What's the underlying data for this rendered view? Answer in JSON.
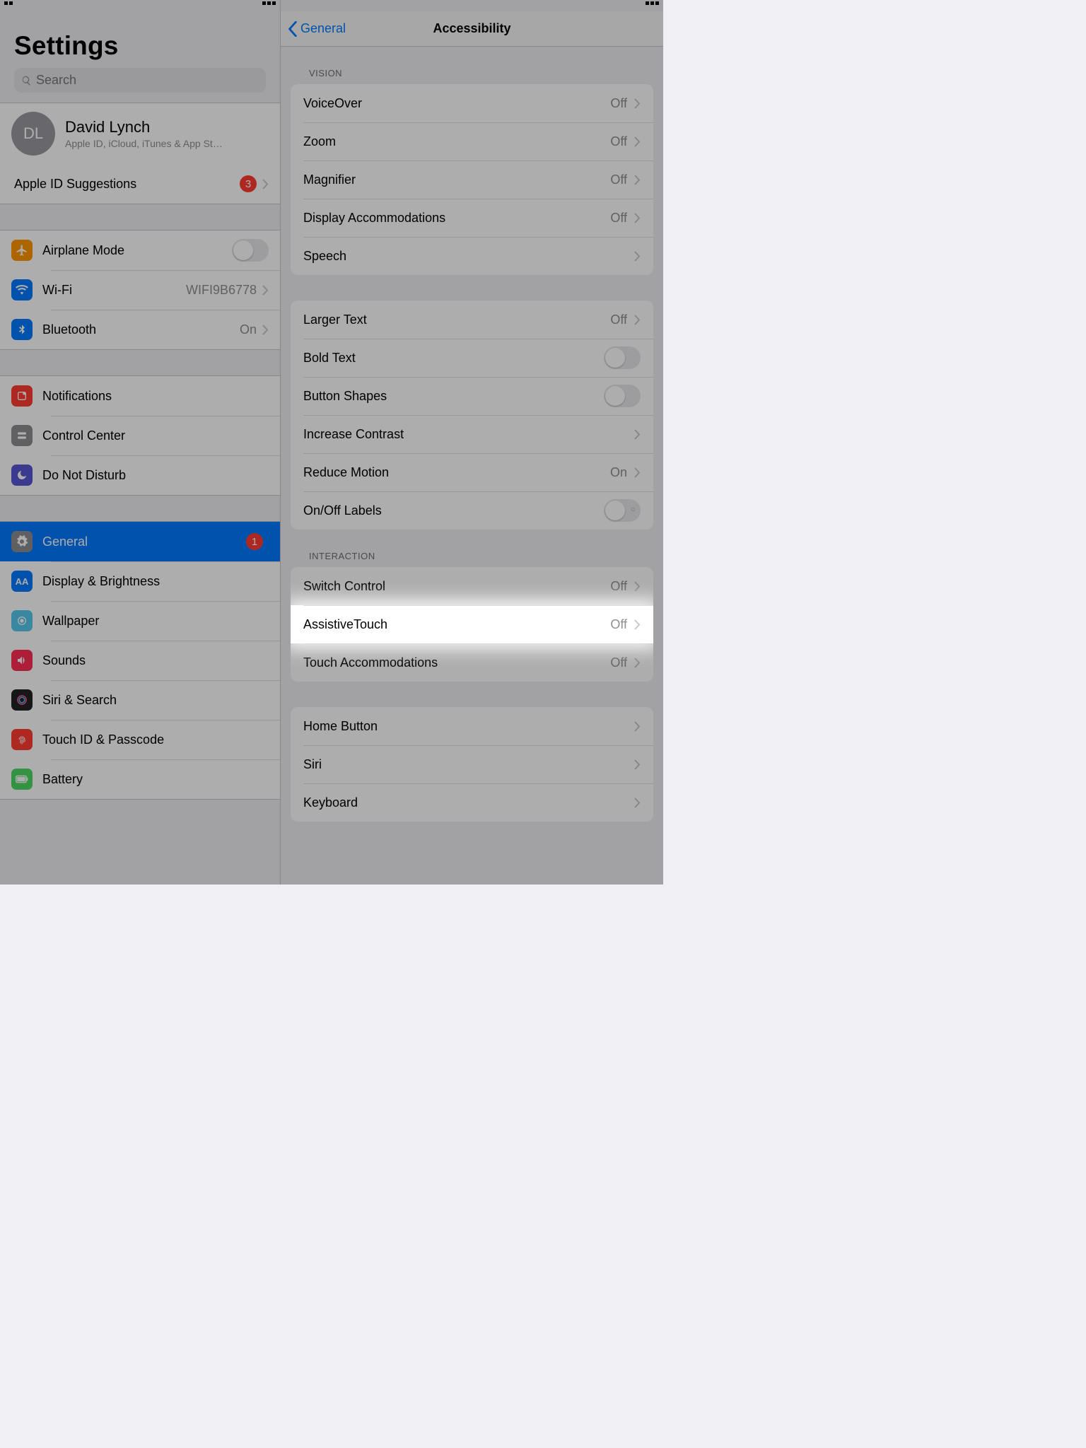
{
  "sidebar": {
    "title": "Settings",
    "search_placeholder": "Search",
    "account": {
      "initials": "DL",
      "name": "David Lynch",
      "subtitle": "Apple ID, iCloud, iTunes & App St…"
    },
    "apple_id_suggestions": {
      "label": "Apple ID Suggestions",
      "badge": "3"
    },
    "rows": {
      "airplane": {
        "label": "Airplane Mode"
      },
      "wifi": {
        "label": "Wi-Fi",
        "value": "WIFI9B6778"
      },
      "bluetooth": {
        "label": "Bluetooth",
        "value": "On"
      },
      "notifications": {
        "label": "Notifications"
      },
      "controlcenter": {
        "label": "Control Center"
      },
      "dnd": {
        "label": "Do Not Disturb"
      },
      "general": {
        "label": "General",
        "badge": "1"
      },
      "display": {
        "label": "Display & Brightness"
      },
      "wallpaper": {
        "label": "Wallpaper"
      },
      "sounds": {
        "label": "Sounds"
      },
      "siri": {
        "label": "Siri & Search"
      },
      "touchid": {
        "label": "Touch ID & Passcode"
      },
      "battery": {
        "label": "Battery"
      }
    }
  },
  "detail": {
    "back_label": "General",
    "title": "Accessibility",
    "sections": {
      "vision": {
        "header": "VISION",
        "items": {
          "voiceover": {
            "label": "VoiceOver",
            "value": "Off"
          },
          "zoom": {
            "label": "Zoom",
            "value": "Off"
          },
          "magnifier": {
            "label": "Magnifier",
            "value": "Off"
          },
          "display_acc": {
            "label": "Display Accommodations",
            "value": "Off"
          },
          "speech": {
            "label": "Speech"
          }
        }
      },
      "text": {
        "items": {
          "larger_text": {
            "label": "Larger Text",
            "value": "Off"
          },
          "bold_text": {
            "label": "Bold Text"
          },
          "button_shapes": {
            "label": "Button Shapes"
          },
          "increase_contrast": {
            "label": "Increase Contrast"
          },
          "reduce_motion": {
            "label": "Reduce Motion",
            "value": "On"
          },
          "onoff_labels": {
            "label": "On/Off Labels"
          }
        }
      },
      "interaction": {
        "header": "INTERACTION",
        "items": {
          "switch_control": {
            "label": "Switch Control",
            "value": "Off"
          },
          "assistive_touch": {
            "label": "AssistiveTouch",
            "value": "Off"
          },
          "touch_acc": {
            "label": "Touch Accommodations",
            "value": "Off"
          }
        }
      },
      "more": {
        "items": {
          "home_button": {
            "label": "Home Button"
          },
          "siri": {
            "label": "Siri"
          },
          "keyboard": {
            "label": "Keyboard"
          }
        }
      }
    }
  },
  "colors": {
    "airplane": "#ff9500",
    "wifi": "#007aff",
    "bluetooth": "#007aff",
    "notifications": "#ff3b30",
    "controlcenter": "#8e8e93",
    "dnd": "#5856d6",
    "general": "#8e8e93",
    "display": "#007aff",
    "wallpaper": "#54c7ec",
    "sounds": "#ff2d55",
    "siri": "#000",
    "touchid": "#ff3b30",
    "battery": "#4cd964"
  }
}
